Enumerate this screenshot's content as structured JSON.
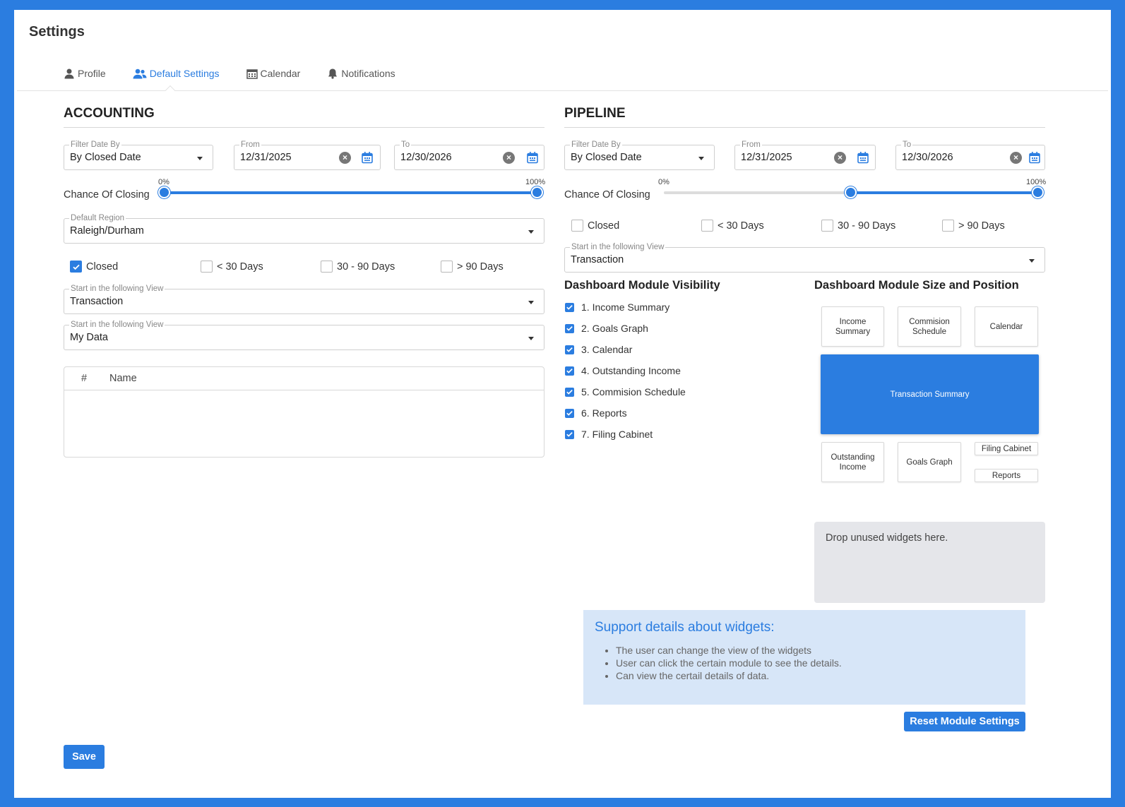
{
  "page_title": "Settings",
  "tabs": [
    {
      "label": "Profile",
      "icon": "user-icon"
    },
    {
      "label": "Default Settings",
      "icon": "users-icon",
      "active": true
    },
    {
      "label": "Calendar",
      "icon": "calendar-icon"
    },
    {
      "label": "Notifications",
      "icon": "bell-icon"
    }
  ],
  "accounting": {
    "title": "ACCOUNTING",
    "filter_label": "Filter Date By",
    "filter_value": "By Closed Date",
    "from_label": "From",
    "from_value": "12/31/2025",
    "to_label": "To",
    "to_value": "12/30/2026",
    "chance_label": "Chance Of Closing",
    "chance_min_label": "0%",
    "chance_max_label": "100%",
    "chance_low": 0,
    "chance_high": 100,
    "region_label": "Default Region",
    "region_value": "Raleigh/Durham",
    "checks": [
      {
        "label": "Closed",
        "checked": true
      },
      {
        "label": "< 30 Days",
        "checked": false
      },
      {
        "label": "30 - 90 Days",
        "checked": false
      },
      {
        "label": "> 90 Days",
        "checked": false
      }
    ],
    "view1_label": "Start in the following View",
    "view1_value": "Transaction",
    "view2_label": "Start in the following View",
    "view2_value": "My Data",
    "table_cols": [
      "#",
      "Name"
    ]
  },
  "pipeline": {
    "title": "PIPELINE",
    "filter_label": "Filter Date By",
    "filter_value": "By Closed Date",
    "from_label": "From",
    "from_value": "12/31/2025",
    "to_label": "To",
    "to_value": "12/30/2026",
    "chance_label": "Chance Of Closing",
    "chance_min_label": "0%",
    "chance_max_label": "100%",
    "chance_low": 50,
    "chance_high": 100,
    "checks": [
      {
        "label": "Closed",
        "checked": false
      },
      {
        "label": "< 30 Days",
        "checked": false
      },
      {
        "label": "30 - 90 Days",
        "checked": false
      },
      {
        "label": "> 90 Days",
        "checked": false
      }
    ],
    "view_label": "Start in the following View",
    "view_value": "Transaction"
  },
  "visibility": {
    "title": "Dashboard Module Visibility",
    "items": [
      "1. Income Summary",
      "2. Goals Graph",
      "3. Calendar",
      "4. Outstanding Income",
      "5. Commision Schedule",
      "6. Reports",
      "7. Filing Cabinet"
    ]
  },
  "layout": {
    "title": "Dashboard Module Size and Position",
    "tiles": {
      "income_summary": "Income Summary",
      "commision_schedule": "Commision Schedule",
      "calendar": "Calendar",
      "transaction_summary": "Transaction Summary",
      "outstanding_income": "Outstanding Income",
      "goals_graph": "Goals Graph",
      "filing_cabinet": "Filing Cabinet",
      "reports": "Reports"
    },
    "drop_text": "Drop unused widgets here."
  },
  "support": {
    "title": "Support details about widgets:",
    "items": [
      "The user can change the view of the widgets",
      "User can click the certain module to see the details.",
      "Can view the certail details of data."
    ]
  },
  "buttons": {
    "reset": "Reset Module Settings",
    "save": "Save"
  },
  "colors": {
    "accent": "#2b7de0",
    "frame": "#2b7de0"
  }
}
